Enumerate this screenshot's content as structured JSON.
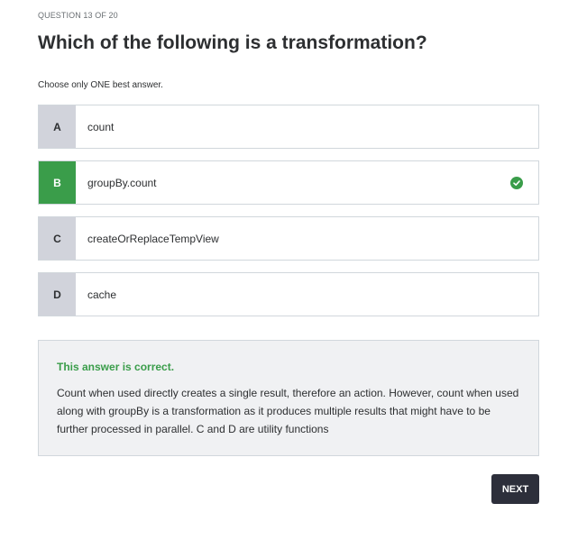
{
  "quiz": {
    "progress": "QUESTION 13 OF 20",
    "question": "Which of the following is a transformation?",
    "instruction": "Choose only ONE best answer."
  },
  "options": [
    {
      "letter": "A",
      "text": "count",
      "correct": false
    },
    {
      "letter": "B",
      "text": "groupBy.count",
      "correct": true
    },
    {
      "letter": "C",
      "text": "createOrReplaceTempView",
      "correct": false
    },
    {
      "letter": "D",
      "text": "cache",
      "correct": false
    }
  ],
  "feedback": {
    "title": "This answer is correct.",
    "body": "Count when used directly creates a single result, therefore an action. However, count when used along with groupBy is a transformation as it produces multiple results that might have to be further processed in parallel. C and D are utility functions"
  },
  "actions": {
    "next_label": "NEXT"
  },
  "colors": {
    "correct": "#3a9d4a",
    "letter_bg": "#d1d3db",
    "feedback_bg": "#f0f1f3",
    "button_bg": "#2d2f3b"
  },
  "icons": {
    "correct_indicator": "check-circle-icon"
  }
}
